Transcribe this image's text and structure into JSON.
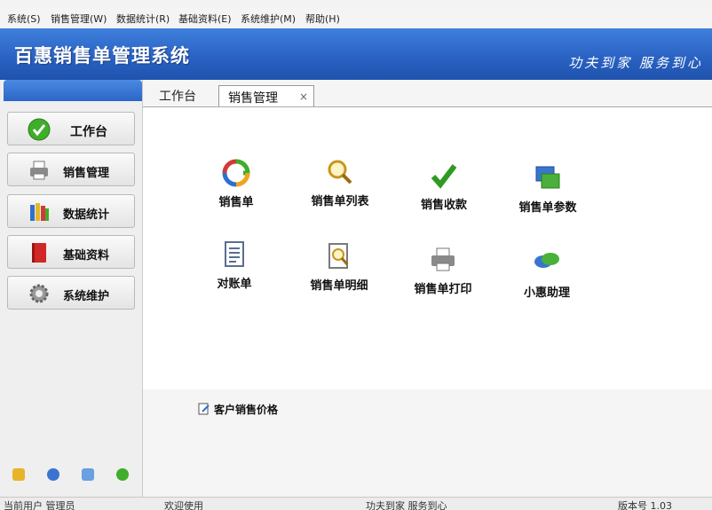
{
  "menu": [
    "系统(S)",
    "销售管理(W)",
    "数据统计(R)",
    "基础资料(E)",
    "系统维护(M)",
    "帮助(H)"
  ],
  "banner": {
    "title": "百惠销售单管理系统",
    "slogan": "功夫到家 服务到心"
  },
  "nav": [
    {
      "label": "工作台",
      "icon": "check-icon",
      "color": "#3fae2a"
    },
    {
      "label": "销售管理",
      "icon": "printer-icon",
      "color": "#8a8a8a"
    },
    {
      "label": "数据统计",
      "icon": "books-icon",
      "color": "#2f6fd0"
    },
    {
      "label": "基础资料",
      "icon": "red-book-icon",
      "color": "#d02727"
    },
    {
      "label": "系统维护",
      "icon": "gear-icon",
      "color": "#8d8d8d"
    }
  ],
  "tabs": {
    "home": "工作台",
    "active": "销售管理",
    "close": "×"
  },
  "functions": [
    {
      "label": "销售单",
      "icon": "refresh-arrows-icon"
    },
    {
      "label": "销售单列表",
      "icon": "magnifier-icon"
    },
    {
      "label": "销售收款",
      "icon": "checkmark-icon"
    },
    {
      "label": "销售单参数",
      "icon": "windows-icon"
    },
    {
      "label": "对账单",
      "icon": "document-icon"
    },
    {
      "label": "销售单明细",
      "icon": "document-search-icon"
    },
    {
      "label": "销售单打印",
      "icon": "printer-icon"
    },
    {
      "label": "小惠助理",
      "icon": "chat-bubbles-icon"
    }
  ],
  "quick_link": {
    "label": "客户销售价格",
    "icon": "edit-icon"
  },
  "status": {
    "left": "当前用户 管理员",
    "welcome": "欢迎使用",
    "slogan": "功夫到家 服务到心",
    "version": "版本号 1.03"
  },
  "colors": {
    "banner": "#2a63c4",
    "accent": "#3fae2a"
  }
}
